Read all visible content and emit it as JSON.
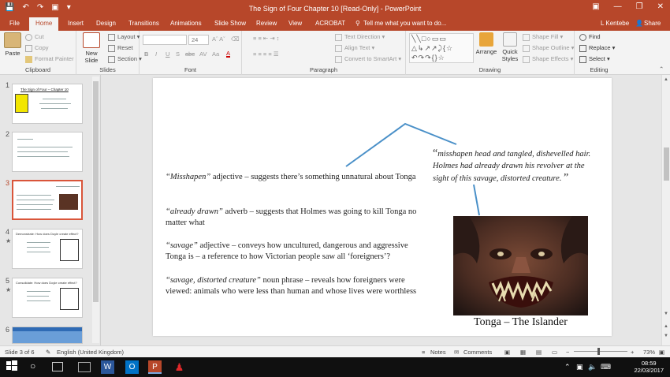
{
  "titlebar": {
    "title": "The Sign of Four  Chapter 10 [Read-Only] - PowerPoint",
    "qat": [
      "💾",
      "↶",
      "↷",
      "▣",
      "▾"
    ],
    "min": "—",
    "restore": "❐",
    "close": "✕"
  },
  "tabs": {
    "file": "File",
    "home": "Home",
    "insert": "Insert",
    "design": "Design",
    "transitions": "Transitions",
    "animations": "Animations",
    "slideshow": "Slide Show",
    "review": "Review",
    "view": "View",
    "acrobat": "ACROBAT",
    "tellme": "Tell me what you want to do...",
    "user": "L Kentebe",
    "share": "Share"
  },
  "ribbon": {
    "clipboard": {
      "label": "Clipboard",
      "paste": "Paste",
      "cut": "Cut",
      "copy": "Copy",
      "format_painter": "Format Painter"
    },
    "slides": {
      "label": "Slides",
      "new_slide": "New Slide",
      "layout": "Layout",
      "reset": "Reset",
      "section": "Section"
    },
    "font": {
      "label": "Font",
      "font_name": "",
      "font_size": "24",
      "bold": "B",
      "italic": "I",
      "underline": "U",
      "strike": "S",
      "shadow": "abc",
      "spacing": "AV",
      "case": "Aa",
      "color": "A"
    },
    "paragraph": {
      "label": "Paragraph",
      "text_direction": "Text Direction",
      "align_text": "Align Text",
      "convert": "Convert to SmartArt"
    },
    "drawing": {
      "label": "Drawing",
      "arrange": "Arrange",
      "quick_styles": "Quick Styles",
      "shape_fill": "Shape Fill",
      "shape_outline": "Shape Outline",
      "shape_effects": "Shape Effects"
    },
    "editing": {
      "label": "Editing",
      "find": "Find",
      "replace": "Replace",
      "select": "Select"
    }
  },
  "thumbnails": [
    {
      "num": "1",
      "title": "The Sign of Four – Chapter 10"
    },
    {
      "num": "2",
      "title": ""
    },
    {
      "num": "3",
      "title": ""
    },
    {
      "num": "4",
      "title": "Demonstrate: How does Doyle create effect?",
      "star": "★"
    },
    {
      "num": "5",
      "title": "Consolidate: How does Doyle create effect?",
      "star": "★"
    },
    {
      "num": "6",
      "title": ""
    }
  ],
  "slide": {
    "quote_open": "“",
    "quote": "misshapen head and tangled, dishevelled hair. Holmes had already drawn his revolver at the sight of this savage, distorted creature.",
    "quote_close": "”",
    "p1_q": "“Misshapen”",
    "p1": " adjective – suggests there’s something unnatural about Tonga",
    "p2_q": "“already drawn”",
    "p2": " adverb – suggests that Holmes was going to kill Tonga no matter what",
    "p3_q": "“savage”",
    "p3": " adjective – conveys how uncultured, dangerous and aggressive Tonga is – a reference to how Victorian people saw all ‘foreigners’?",
    "p4_q": "“savage, distorted creature”",
    "p4": " noun phrase – reveals how foreigners were viewed: animals who were less than human and whose lives were worthless",
    "caption": "Tonga – The Islander"
  },
  "status": {
    "slide_count": "Slide 3 of 6",
    "language": "English (United Kingdom)",
    "notes": "Notes",
    "comments": "Comments",
    "zoom": "73%"
  },
  "taskbar": {
    "time": "08:59",
    "date": "22/03/2017"
  },
  "colors": {
    "accent": "#b7472a",
    "connector": "#4a90c8"
  }
}
